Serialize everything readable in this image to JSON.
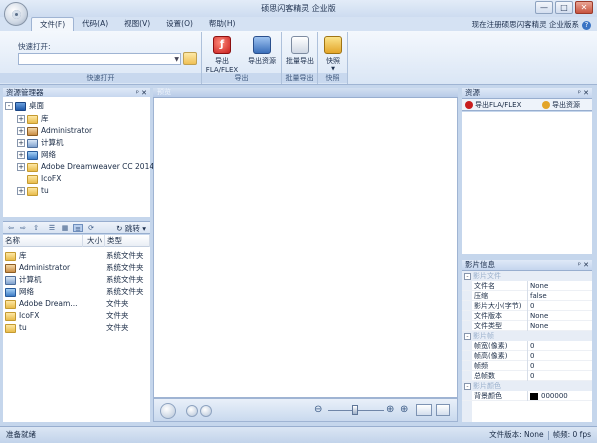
{
  "window": {
    "title": "硕思闪客精灵 企业版",
    "minimize": "—",
    "maximize": "□",
    "close": "✕"
  },
  "menu": {
    "tabs": [
      "文件(F)",
      "代码(A)",
      "视图(V)",
      "设置(O)",
      "帮助(H)"
    ],
    "right_text": "现在注册硕思闪客精灵 企业版系",
    "help_icon": "?"
  },
  "ribbon": {
    "quick_open": {
      "label": "快速打开:",
      "group": "快速打开"
    },
    "export_group": "导出",
    "export_flash": "导出FLA/FLEX",
    "export_resources": "导出资源",
    "batch_group": "批量导出",
    "batch_export": "批量导出",
    "fast_group": "快照",
    "fast_button": "快照"
  },
  "explorer": {
    "title": "资源管理器",
    "tree": [
      {
        "label": "桌面",
        "icon": "desktop-icon",
        "level": 0,
        "expander": "-"
      },
      {
        "label": "库",
        "icon": "library-icon",
        "level": 1,
        "expander": "+"
      },
      {
        "label": "Administrator",
        "icon": "user-folder-icon",
        "level": 1,
        "expander": "+"
      },
      {
        "label": "计算机",
        "icon": "computer-icon",
        "level": 1,
        "expander": "+"
      },
      {
        "label": "网络",
        "icon": "network-icon",
        "level": 1,
        "expander": "+"
      },
      {
        "label": "Adobe Dreamweaver CC 2014",
        "icon": "folder-icon",
        "level": 1,
        "expander": "+"
      },
      {
        "label": "IcoFX",
        "icon": "folder-icon",
        "level": 1,
        "expander": ""
      },
      {
        "label": "tu",
        "icon": "folder-icon",
        "level": 1,
        "expander": "+"
      }
    ],
    "jump": "跳转",
    "list_headers": {
      "name": "名称",
      "size": "大小",
      "type": "类型"
    },
    "list_rows": [
      {
        "name": "库",
        "type": "系统文件夹",
        "icon": "library-icon"
      },
      {
        "name": "Administrator",
        "type": "系统文件夹",
        "icon": "user-folder-icon"
      },
      {
        "name": "计算机",
        "type": "系统文件夹",
        "icon": "computer-icon"
      },
      {
        "name": "网络",
        "type": "系统文件夹",
        "icon": "network-icon"
      },
      {
        "name": "Adobe Dream...",
        "type": "文件夹",
        "icon": "folder-icon"
      },
      {
        "name": "IcoFX",
        "type": "文件夹",
        "icon": "folder-icon"
      },
      {
        "name": "tu",
        "type": "文件夹",
        "icon": "folder-icon"
      }
    ]
  },
  "stage": {
    "tab": "预览"
  },
  "resources": {
    "title": "资源",
    "tab_export_flash": "导出FLA/FLEX",
    "tab_export_res": "导出资源"
  },
  "properties": {
    "title": "影片信息",
    "groups": [
      {
        "name": "影片文件",
        "rows": [
          {
            "key": "文件名",
            "value": "None"
          },
          {
            "key": "压缩",
            "value": "false"
          },
          {
            "key": "影片大小(字节)",
            "value": "0"
          },
          {
            "key": "文件版本",
            "value": "None"
          },
          {
            "key": "文件类型",
            "value": "None"
          }
        ]
      },
      {
        "name": "影片帧",
        "rows": [
          {
            "key": "帧宽(像素)",
            "value": "0"
          },
          {
            "key": "帧高(像素)",
            "value": "0"
          },
          {
            "key": "帧频",
            "value": "0"
          },
          {
            "key": "总帧数",
            "value": "0"
          }
        ]
      },
      {
        "name": "影片颜色",
        "rows": [
          {
            "key": "背景颜色",
            "value": "000000"
          }
        ]
      }
    ]
  },
  "status": {
    "left": "准备就绪",
    "version": "文件版本: None",
    "fps": "帧频: 0 fps"
  },
  "colors": {
    "accent": "#3b74c4",
    "panel_bg": "#c5d6ec",
    "swatch": "#000000"
  }
}
